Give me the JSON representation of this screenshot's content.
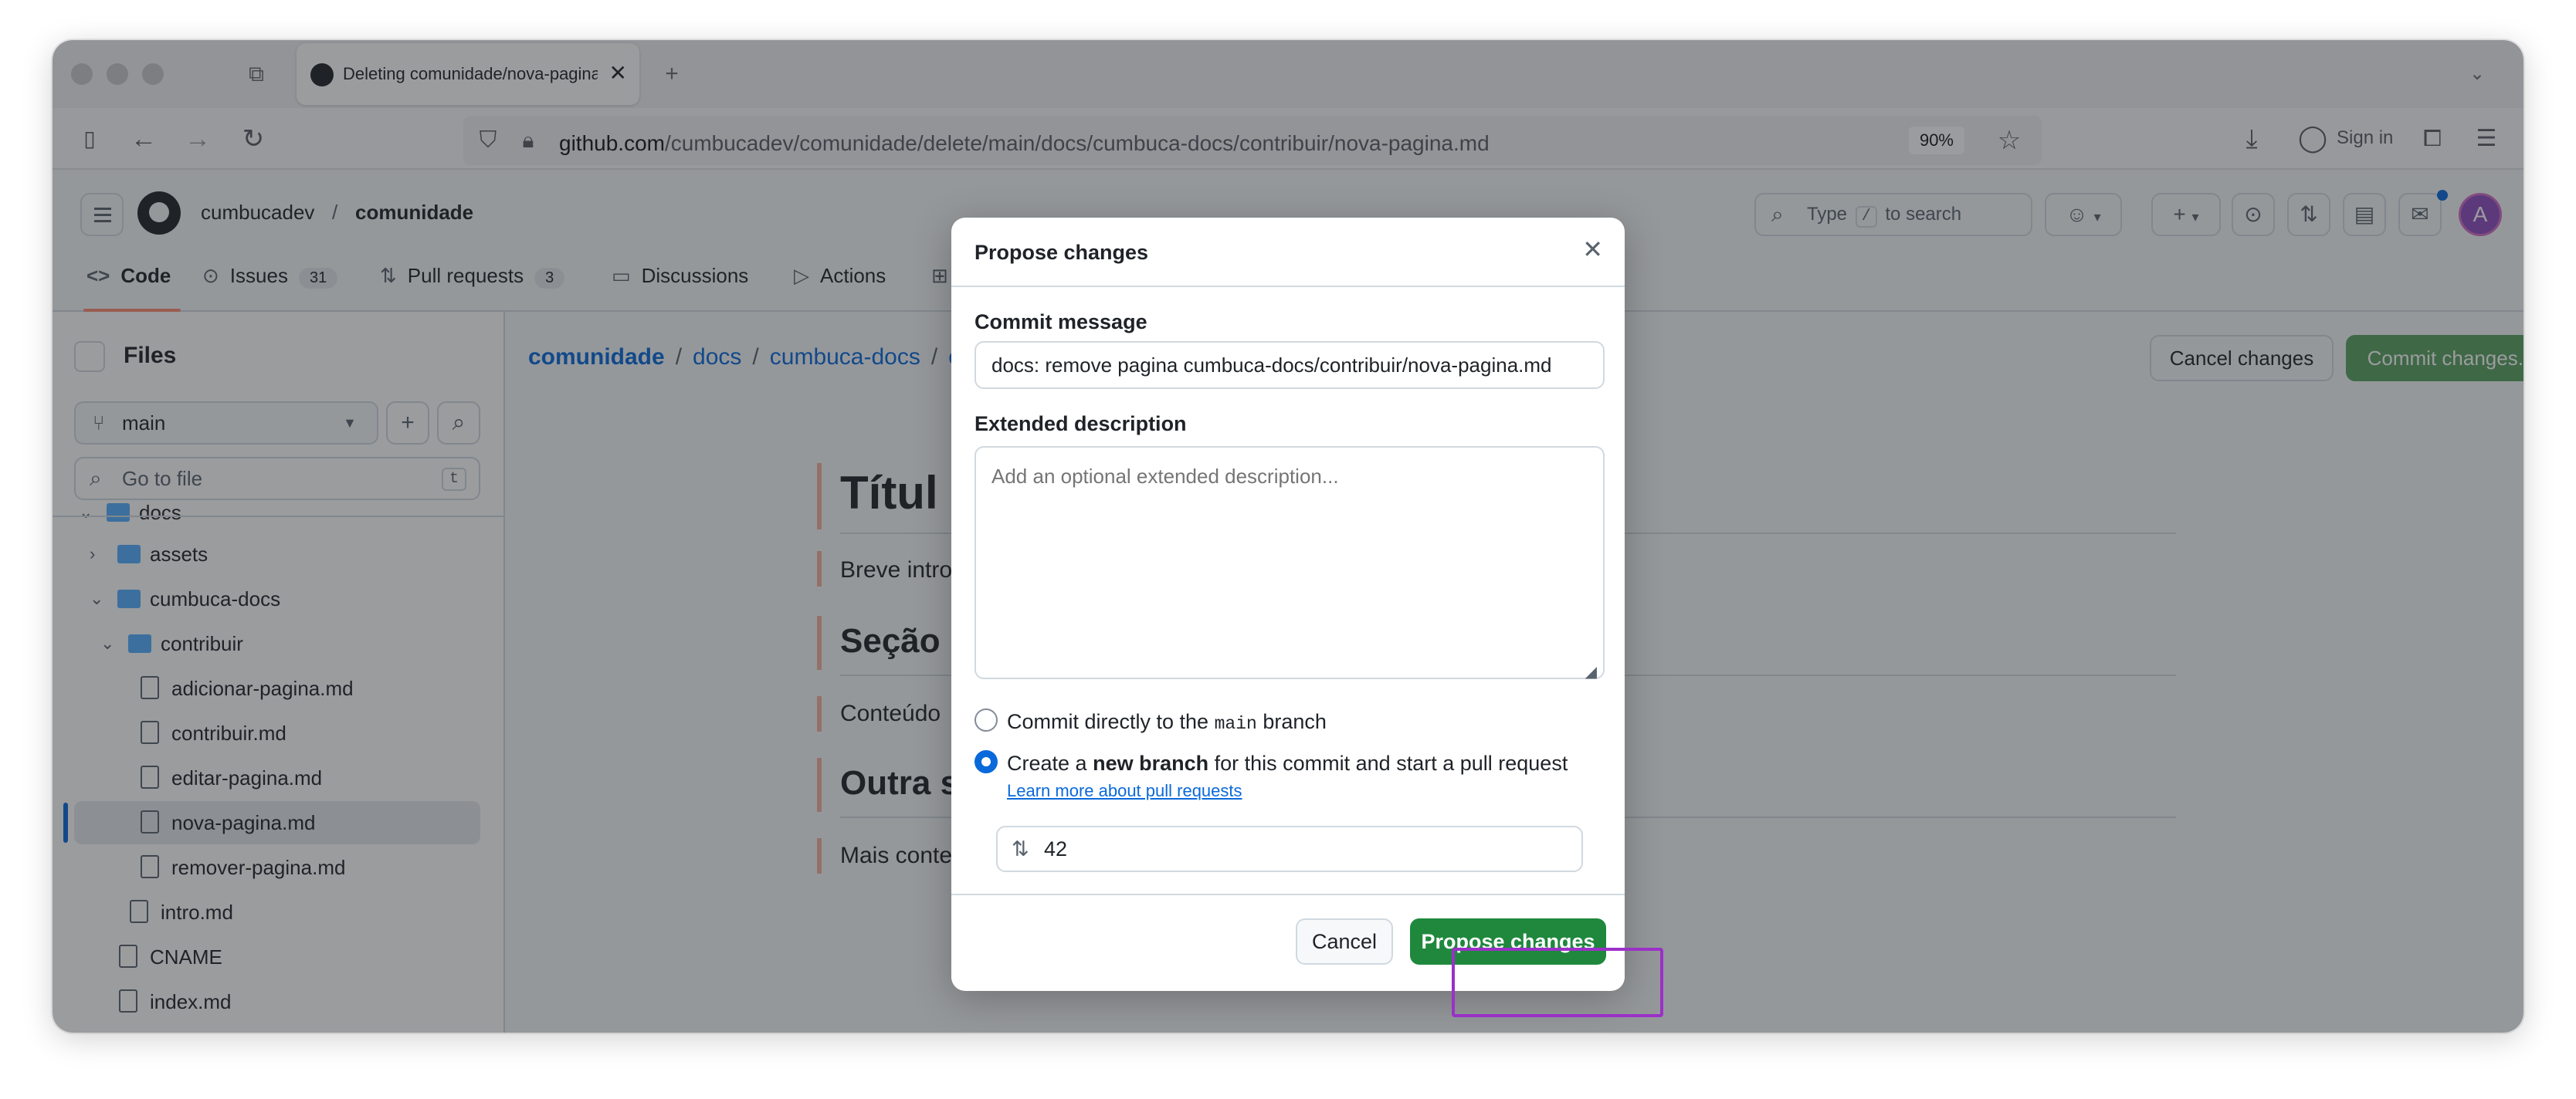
{
  "browser": {
    "tab_title": "Deleting comunidade/nova-pagina.md",
    "url_domain": "github.com",
    "url_path": "/cumbucadev/comunidade/delete/main/docs/cumbuca-docs/contribuir/nova-pagina.md",
    "zoom": "90%",
    "sign_in": "Sign in"
  },
  "header": {
    "owner": "cumbucadev",
    "separator": "/",
    "repo": "comunidade",
    "search_prefix": "Type",
    "search_key": "/",
    "search_suffix": "to search",
    "avatar_letter": "A"
  },
  "repo_tabs": [
    {
      "label": "Code",
      "icon": "code-icon",
      "count": ""
    },
    {
      "label": "Issues",
      "icon": "issue-icon",
      "count": "31"
    },
    {
      "label": "Pull requests",
      "icon": "pull-request-icon",
      "count": "3"
    },
    {
      "label": "Discussions",
      "icon": "discussion-icon",
      "count": ""
    },
    {
      "label": "Actions",
      "icon": "play-icon",
      "count": ""
    }
  ],
  "sidebar": {
    "title": "Files",
    "branch": "main",
    "goto_placeholder": "Go to file",
    "goto_key": "t",
    "tree": [
      {
        "label": "docs",
        "type": "folder"
      },
      {
        "label": "assets",
        "type": "folder"
      },
      {
        "label": "cumbuca-docs",
        "type": "folder"
      },
      {
        "label": "contribuir",
        "type": "folder"
      },
      {
        "label": "adicionar-pagina.md",
        "type": "file"
      },
      {
        "label": "contribuir.md",
        "type": "file"
      },
      {
        "label": "editar-pagina.md",
        "type": "file"
      },
      {
        "label": "nova-pagina.md",
        "type": "file",
        "selected": true
      },
      {
        "label": "remover-pagina.md",
        "type": "file"
      },
      {
        "label": "intro.md",
        "type": "file"
      },
      {
        "label": "CNAME",
        "type": "file"
      },
      {
        "label": "index.md",
        "type": "file"
      }
    ]
  },
  "main": {
    "breadcrumb": [
      "comunidade",
      "docs",
      "cumbuca-docs"
    ],
    "breadcrumb_trailing": "c",
    "cancel_changes": "Cancel changes",
    "commit_changes": "Commit changes...",
    "markdown": {
      "h1": "Títul",
      "p1": "Breve intro",
      "h2a": "Seção",
      "p2": "Conteúdo",
      "h2b": "Outra s",
      "p3": "Mais conte"
    }
  },
  "dialog": {
    "title": "Propose changes",
    "commit_message_label": "Commit message",
    "commit_message_value": "docs: remove pagina cumbuca-docs/contribuir/nova-pagina.md",
    "extended_label": "Extended description",
    "extended_placeholder": "Add an optional extended description...",
    "option_direct_pre": "Commit directly to the",
    "option_direct_code": "main",
    "option_direct_post": "branch",
    "option_new_pre": "Create a",
    "option_new_bold": "new branch",
    "option_new_post": "for this commit and start a pull request",
    "learn_more": "Learn more about pull requests",
    "branch_name": "42",
    "cancel": "Cancel",
    "propose": "Propose changes"
  },
  "colors": {
    "primary_button": "#1f883d",
    "link": "#0969da",
    "highlight_outline": "#9b30c8"
  }
}
